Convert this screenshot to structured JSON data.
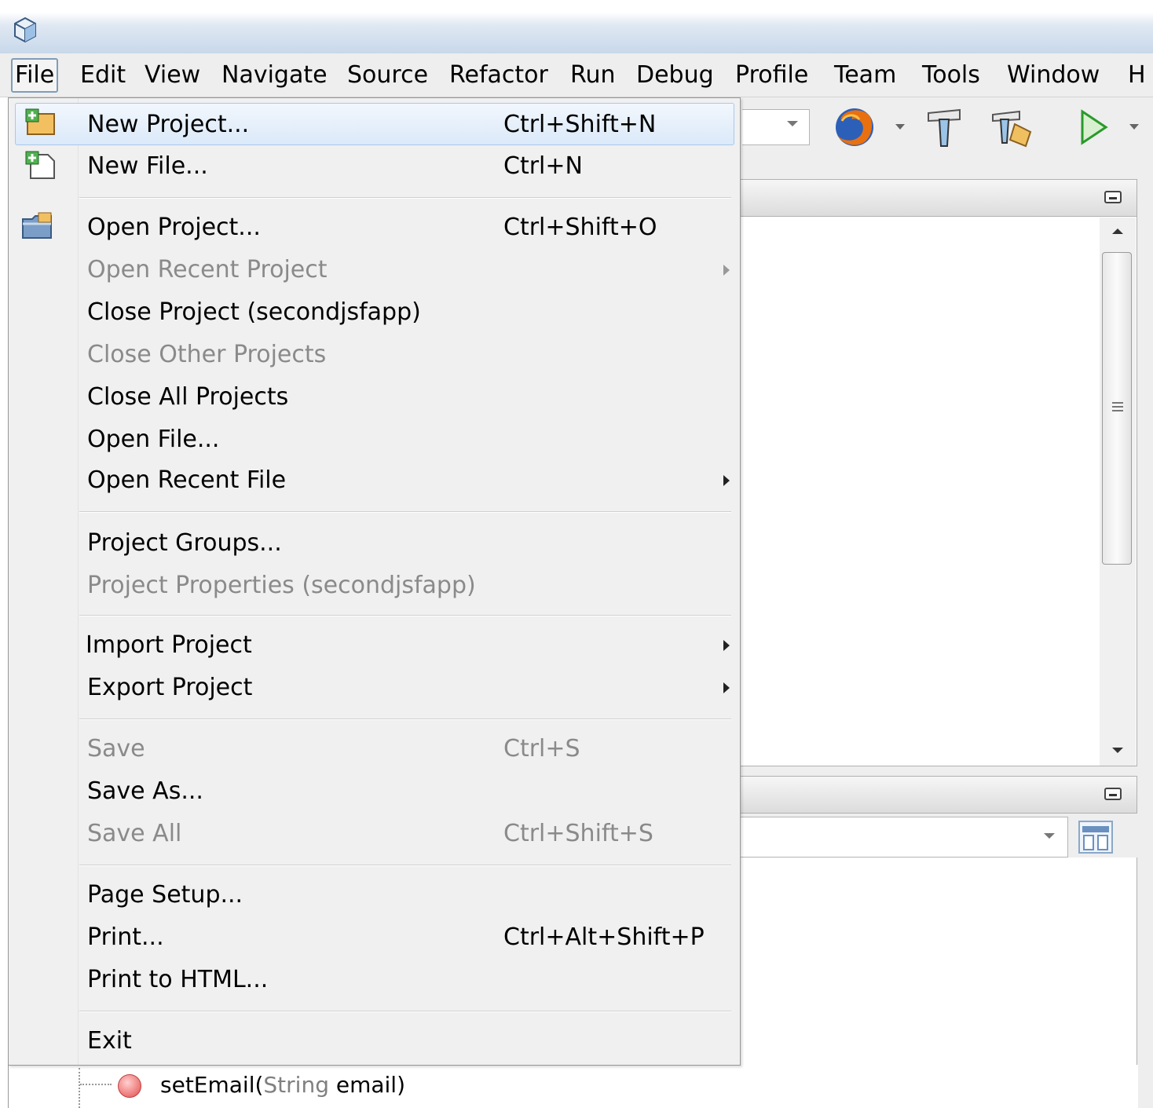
{
  "menubar": {
    "items": [
      "File",
      "Edit",
      "View",
      "Navigate",
      "Source",
      "Refactor",
      "Run",
      "Debug",
      "Profile",
      "Team",
      "Tools",
      "Window",
      "H"
    ]
  },
  "file_menu": {
    "items": [
      {
        "label": "New Project...",
        "shortcut": "Ctrl+Shift+N",
        "enabled": true,
        "highlighted": true,
        "icon": "new-project-icon"
      },
      {
        "label": "New File...",
        "shortcut": "Ctrl+N",
        "enabled": true,
        "icon": "new-file-icon"
      },
      {
        "label": "Open Project...",
        "shortcut": "Ctrl+Shift+O",
        "enabled": true,
        "icon": "open-project-icon"
      },
      {
        "label": "Open Recent Project",
        "shortcut": "",
        "enabled": false,
        "submenu": true
      },
      {
        "label": "Close Project (secondjsfapp)",
        "shortcut": "",
        "enabled": true
      },
      {
        "label": "Close Other Projects",
        "shortcut": "",
        "enabled": false
      },
      {
        "label": "Close All Projects",
        "shortcut": "",
        "enabled": true
      },
      {
        "label": "Open File...",
        "shortcut": "",
        "enabled": true
      },
      {
        "label": "Open Recent File",
        "shortcut": "",
        "enabled": true,
        "submenu": true
      },
      {
        "label": "Project Groups...",
        "shortcut": "",
        "enabled": true
      },
      {
        "label": "Project Properties (secondjsfapp)",
        "shortcut": "",
        "enabled": false
      },
      {
        "label": "Import Project",
        "shortcut": "",
        "enabled": true,
        "submenu": true
      },
      {
        "label": "Export Project",
        "shortcut": "",
        "enabled": true,
        "submenu": true
      },
      {
        "label": "Save",
        "shortcut": "Ctrl+S",
        "enabled": false
      },
      {
        "label": "Save As...",
        "shortcut": "",
        "enabled": true
      },
      {
        "label": "Save All",
        "shortcut": "Ctrl+Shift+S",
        "enabled": false
      },
      {
        "label": "Page Setup...",
        "shortcut": "",
        "enabled": true
      },
      {
        "label": "Print...",
        "shortcut": "Ctrl+Alt+Shift+P",
        "enabled": true
      },
      {
        "label": "Print to HTML...",
        "shortcut": "",
        "enabled": true
      },
      {
        "label": "Exit",
        "shortcut": "",
        "enabled": true
      }
    ]
  },
  "navigator": {
    "method_name": "setEmail(",
    "param_type": "String",
    "param_name": " email)"
  },
  "colors": {
    "menu_bg": "#f0f0f0",
    "highlight_border": "#a8c8ec",
    "disabled_text": "#8a8a8a"
  }
}
